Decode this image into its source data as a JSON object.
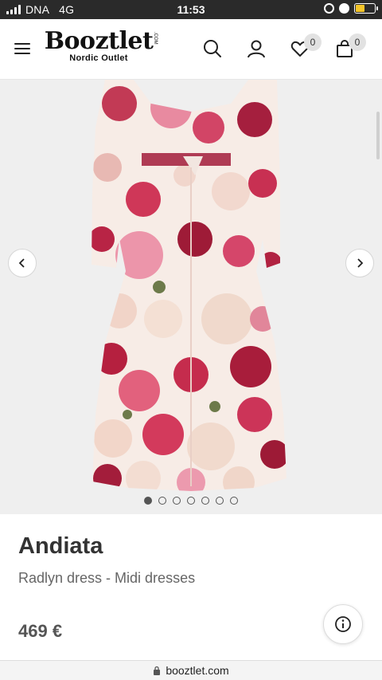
{
  "status_bar": {
    "carrier": "DNA",
    "network": "4G",
    "time": "11:53",
    "battery_color": "#f5c52a"
  },
  "header": {
    "logo_text": "Booztlet",
    "logo_suffix": ".COM",
    "logo_subtitle": "Nordic Outlet",
    "icons": [
      "menu-icon",
      "search-icon",
      "user-icon",
      "heart-icon",
      "shopping-bag-icon"
    ],
    "wishlist_count": "0",
    "cart_count": "0"
  },
  "gallery": {
    "image_description_icon": "floral-dress-image",
    "image_count": 7,
    "active_image_index": 0,
    "prev_icon": "chevron-left-icon",
    "next_icon": "chevron-right-icon"
  },
  "product": {
    "brand": "Andiata",
    "name": "Radlyn dress - Midi dresses",
    "price": "469 €",
    "info_icon": "info-icon"
  },
  "browser": {
    "url": "booztlet.com",
    "lock_icon": "lock-icon"
  },
  "colors": {
    "background_gallery": "#efefef",
    "text_primary": "#333333",
    "text_secondary": "#666666",
    "badge_bg": "#e2e2e2"
  }
}
